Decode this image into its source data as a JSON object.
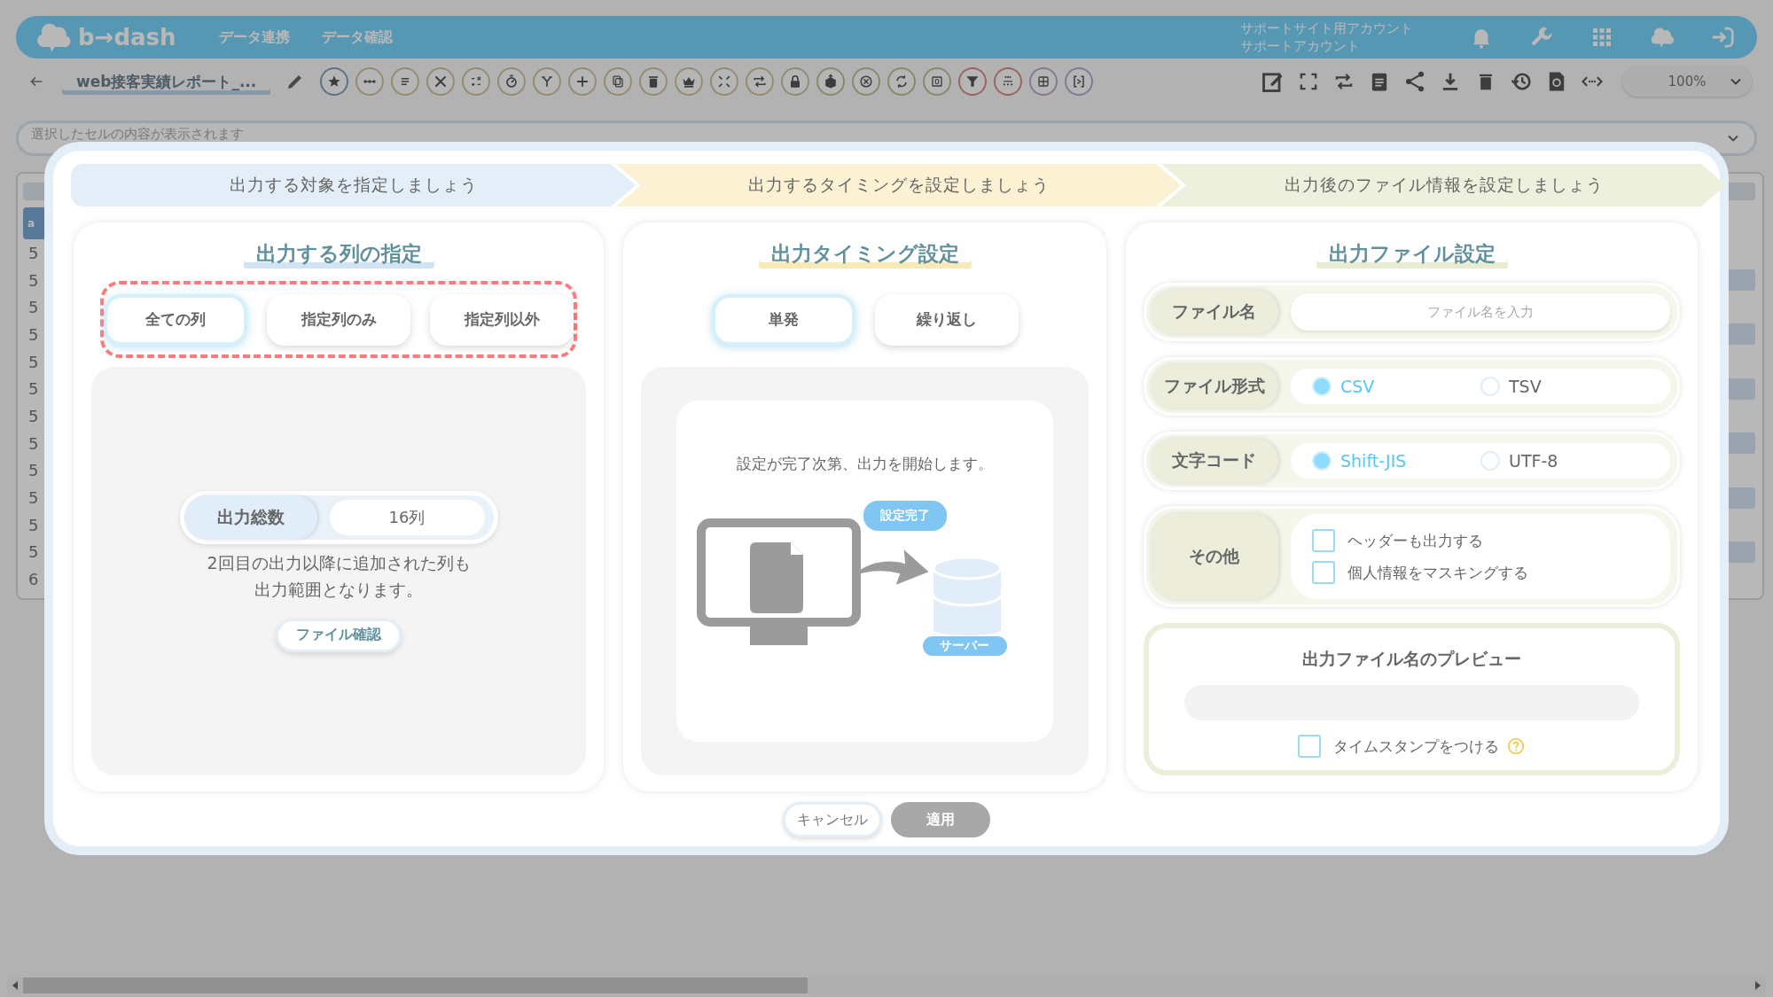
{
  "app": {
    "logo": "b→dash",
    "nav": [
      {
        "label": "データ連携"
      },
      {
        "label": "データ確認"
      }
    ],
    "account": [
      "サポートサイト用アカウント",
      "サポートアカウント"
    ]
  },
  "toolbar": {
    "title": "web接客実績レポート_...",
    "zoom": "100%"
  },
  "formula_bar": {
    "placeholder": "選択したセルの内容が表示されます"
  },
  "sheet": {
    "header": "a",
    "rows": [
      {
        "number": "5"
      },
      {
        "number": "5"
      },
      {
        "number": "5"
      },
      {
        "number": "5"
      },
      {
        "number": "5"
      },
      {
        "number": "5"
      },
      {
        "number": "5"
      },
      {
        "number": "5"
      },
      {
        "number": "5"
      },
      {
        "number": "5"
      },
      {
        "number": "5"
      },
      {
        "number": "5"
      },
      {
        "number": "6"
      }
    ]
  },
  "modal": {
    "steps": [
      {
        "label": "出力する対象を指定しましょう",
        "color": "#e3eef8"
      },
      {
        "label": "出力するタイミングを設定しましょう",
        "color": "#fcf1d2"
      },
      {
        "label": "出力後のファイル情報を設定しましょう",
        "color": "#edf0dc"
      }
    ],
    "column_panel": {
      "title": "出力する列の指定",
      "options": [
        {
          "label": "全ての列",
          "selected": true
        },
        {
          "label": "指定列のみ",
          "selected": false
        },
        {
          "label": "指定列以外",
          "selected": false
        }
      ],
      "total_label": "出力総数",
      "total_value": "16列",
      "note_lines": [
        "2回目の出力以降に追加された列も",
        "出力範囲となります。"
      ],
      "check_button": "ファイル確認"
    },
    "timing_panel": {
      "title": "出力タイミング設定",
      "options": [
        {
          "label": "単発",
          "selected": true
        },
        {
          "label": "繰り返し",
          "selected": false
        }
      ],
      "message": "設定が完了次第、出力を開始します。",
      "badge": "設定完了",
      "server_label": "サーバー"
    },
    "file_panel": {
      "title": "出力ファイル設定",
      "file_name": {
        "label": "ファイル名",
        "placeholder": "ファイル名を入力"
      },
      "format": {
        "label": "ファイル形式",
        "options": [
          {
            "label": "CSV",
            "selected": true
          },
          {
            "label": "TSV",
            "selected": false
          }
        ]
      },
      "encoding": {
        "label": "文字コード",
        "options": [
          {
            "label": "Shift-JIS",
            "selected": true
          },
          {
            "label": "UTF-8",
            "selected": false
          }
        ]
      },
      "other": {
        "label": "その他",
        "options": [
          {
            "label": "ヘッダーも出力する",
            "checked": false
          },
          {
            "label": "個人情報をマスキングする",
            "checked": false
          }
        ]
      },
      "preview": {
        "title": "出力ファイル名のプレビュー",
        "timestamp": {
          "label": "タイムスタンプをつける",
          "checked": false
        }
      }
    },
    "buttons": [
      {
        "label": "キャンセル",
        "disabled": false
      },
      {
        "label": "適用",
        "disabled": true
      }
    ]
  }
}
